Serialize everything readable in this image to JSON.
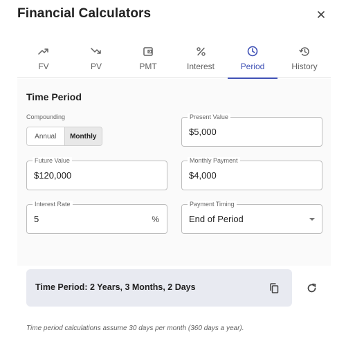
{
  "title": "Financial Calculators",
  "colors": {
    "accent": "#3f51b5",
    "result_bg": "#e8eaf1"
  },
  "tabs": [
    {
      "label": "FV",
      "icon": "trending-up-icon"
    },
    {
      "label": "PV",
      "icon": "trending-down-icon"
    },
    {
      "label": "PMT",
      "icon": "wallet-icon"
    },
    {
      "label": "Interest",
      "icon": "percent-icon"
    },
    {
      "label": "Period",
      "icon": "clock-icon",
      "active": true
    },
    {
      "label": "History",
      "icon": "history-icon"
    }
  ],
  "section": {
    "title": "Time Period",
    "compounding": {
      "label": "Compounding",
      "options": [
        "Annual",
        "Monthly"
      ],
      "selected": "Monthly"
    }
  },
  "fields": {
    "present_value": {
      "label": "Present Value",
      "value": "$5,000"
    },
    "future_value": {
      "label": "Future Value",
      "value": "$120,000"
    },
    "monthly_payment": {
      "label": "Monthly Payment",
      "value": "$4,000"
    },
    "interest_rate": {
      "label": "Interest Rate",
      "value": "5",
      "suffix": "%"
    },
    "payment_timing": {
      "label": "Payment Timing",
      "value": "End of Period"
    }
  },
  "result": {
    "text": "Time Period: 2 Years, 3 Months, 2 Days"
  },
  "note": "Time period calculations assume 30 days per month (360 days a year)."
}
